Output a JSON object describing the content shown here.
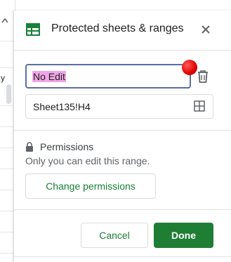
{
  "background": {
    "cell_fragment": "y"
  },
  "panel": {
    "title": "Protected sheets & ranges",
    "description_value": "No Edit",
    "range_value": "Sheet135!H4",
    "permissions": {
      "title": "Permissions",
      "description": "Only you can edit this range.",
      "change_label": "Change permissions"
    },
    "actions": {
      "cancel_label": "Cancel",
      "done_label": "Done"
    }
  },
  "colors": {
    "accent_green": "#188038",
    "done_bg": "#1e7e34",
    "focus_border": "#5b6ea8",
    "text_highlight": "#f0a6e6",
    "cursor_dot": "#e00000"
  },
  "icons": [
    "sheets-grid-icon",
    "close-icon",
    "trash-icon",
    "grid-select-icon",
    "lock-icon",
    "chevron-up-icon"
  ]
}
